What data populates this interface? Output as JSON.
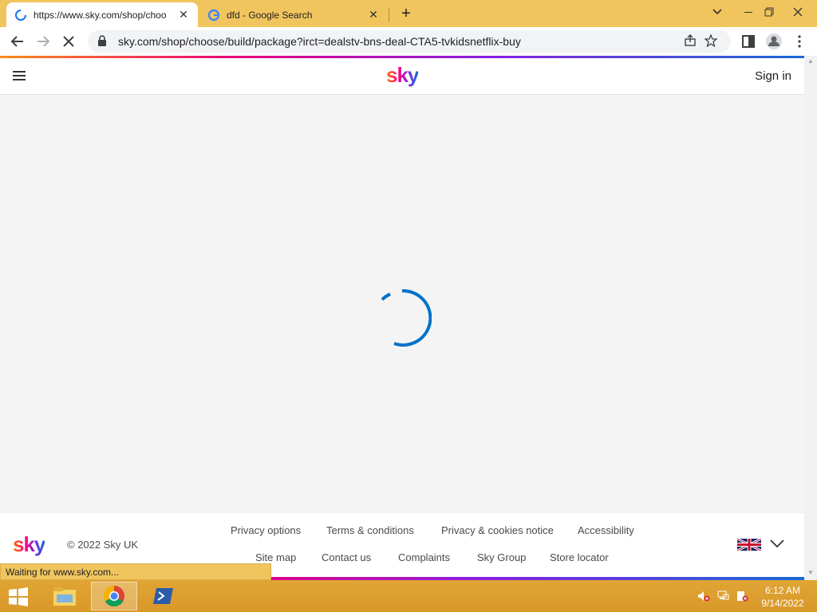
{
  "browser": {
    "tabs": [
      {
        "title": "https://www.sky.com/shop/choo",
        "close": "✕"
      },
      {
        "title": "dfd - Google Search",
        "close": "✕"
      }
    ],
    "new_tab": "+",
    "url": "sky.com/shop/choose/build/package?irct=dealstv-bns-deal-CTA5-tvkidsnetflix-buy",
    "status_text": "Waiting for www.sky.com..."
  },
  "site": {
    "logo": "sky",
    "signin": "Sign in"
  },
  "footer": {
    "logo": "sky",
    "copyright": "© 2022 Sky UK",
    "links_row1": [
      "Privacy options",
      "Terms & conditions",
      "Privacy & cookies notice",
      "Accessibility"
    ],
    "links_row2": [
      "Site map",
      "Contact us",
      "Complaints",
      "Sky Group",
      "Store locator"
    ]
  },
  "taskbar": {
    "time": "6:12 AM",
    "date": "9/14/2022"
  },
  "colors": {
    "accent_blue": "#0072c9",
    "taskbar": "#d9982a"
  }
}
